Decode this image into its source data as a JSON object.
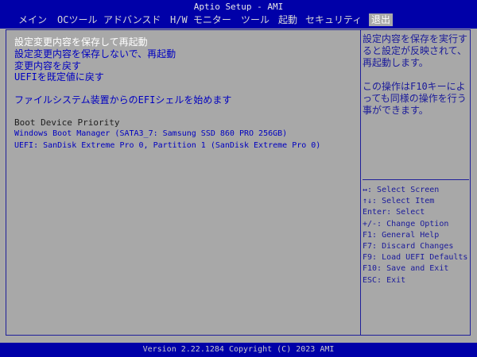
{
  "header": {
    "title": "Aptio Setup - AMI",
    "tabs": [
      "メイン",
      "OCツール",
      "アドバンスド",
      "H/W モニター",
      "ツール",
      "起動",
      "セキュリティ",
      "退出"
    ],
    "active_tab": "退出"
  },
  "menu": {
    "items": [
      "設定変更内容を保存して再起動",
      "設定変更内容を保存しないで、再起動",
      "変更内容を戻す",
      "UEFIを既定値に戻す",
      "ファイルシステム装置からのEFIシェルを始めます"
    ],
    "selected_index": 0
  },
  "boot_override": {
    "title": "Boot Device Priority",
    "devices": [
      "Windows Boot Manager (SATA3_7: Samsung SSD 860 PRO 256GB)",
      "UEFI: SanDisk Extreme Pro 0, Partition 1 (SanDisk Extreme Pro 0)"
    ]
  },
  "help": {
    "lines1": [
      "設定内容を保存を実行す",
      "ると設定が反映されて、",
      "再起動します。"
    ],
    "lines2": [
      "この操作はF10キーによ",
      "っても同様の操作を行う",
      "事ができます。"
    ]
  },
  "keys": [
    "↔: Select Screen",
    "↑↓: Select Item",
    "Enter: Select",
    "+/-: Change Option",
    "F1: General Help",
    "F7: Discard Changes",
    "F9: Load UEFI Defaults",
    "F10: Save and Exit",
    "ESC: Exit"
  ],
  "footer": {
    "version": "Version 2.22.1284 Copyright (C) 2023 AMI"
  },
  "colors": {
    "bar_blue": "#0000a8",
    "panel_gray": "#a8a8a8",
    "item_blue": "#0000c0",
    "selected_white": "#ffffff"
  }
}
